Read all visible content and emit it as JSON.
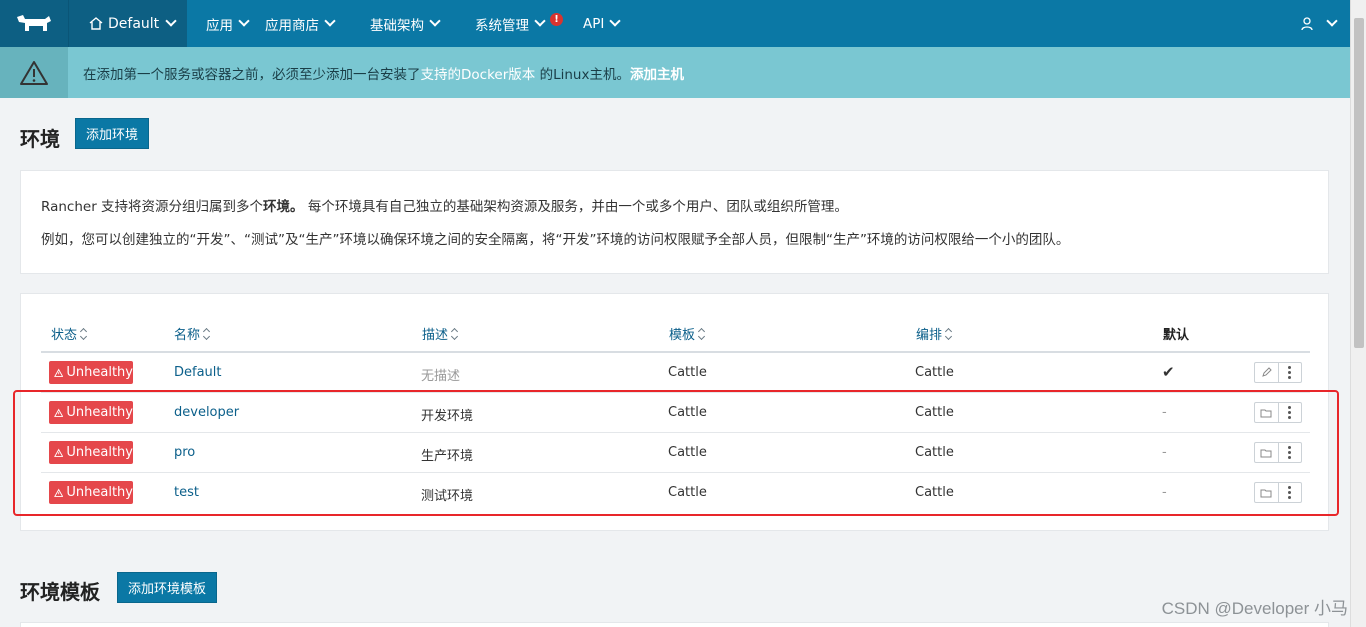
{
  "nav": {
    "env_label": "Default",
    "items": [
      "应用",
      "应用商店",
      "基础架构",
      "系统管理",
      "API"
    ],
    "alert_mark": "!"
  },
  "banner": {
    "text_before": "在添加第一个服务或容器之前，必须至少添加一台安装了",
    "link_docker": "支持的Docker版本",
    "text_mid": " 的Linux主机。",
    "link_add_host": "添加主机"
  },
  "environments": {
    "title": "环境",
    "add_button": "添加环境",
    "info_line1_pre": "Rancher 支持将资源分组归属到多个",
    "info_line1_bold": "环境。",
    "info_line1_post": " 每个环境具有自己独立的基础架构资源及服务，并由一个或多个用户、团队或组织所管理。",
    "info_line2": "例如，您可以创建独立的“开发”、“测试”及“生产”环境以确保环境之间的安全隔离，将“开发”环境的访问权限赋予全部人员，但限制“生产”环境的访问权限给一个小的团队。"
  },
  "table": {
    "headers": {
      "state": "状态",
      "name": "名称",
      "description": "描述",
      "template": "模板",
      "orchestration": "编排",
      "default": "默认"
    },
    "rows": [
      {
        "state": "Unhealthy",
        "name": "Default",
        "description": "无描述",
        "template": "Cattle",
        "orchestration": "Cattle",
        "default": "✔"
      },
      {
        "state": "Unhealthy",
        "name": "developer",
        "description": "开发环境",
        "template": "Cattle",
        "orchestration": "Cattle",
        "default": "-"
      },
      {
        "state": "Unhealthy",
        "name": "pro",
        "description": "生产环境",
        "template": "Cattle",
        "orchestration": "Cattle",
        "default": "-"
      },
      {
        "state": "Unhealthy",
        "name": "test",
        "description": "测试环境",
        "template": "Cattle",
        "orchestration": "Cattle",
        "default": "-"
      }
    ]
  },
  "templates": {
    "title": "环境模板",
    "add_button": "添加环境模板"
  },
  "watermark": "CSDN @Developer 小马",
  "colors": {
    "nav": "#0b78a5",
    "banner": "#7ac7d2",
    "badge": "#e5474b",
    "highlight": "#e8262a"
  }
}
